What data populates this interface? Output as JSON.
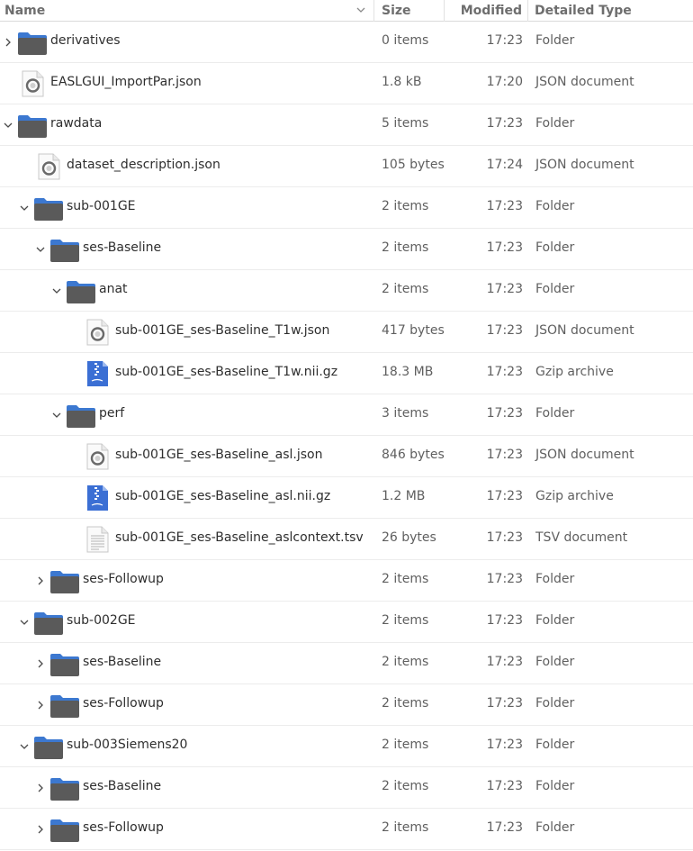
{
  "header": {
    "name": "Name",
    "size": "Size",
    "modified": "Modified",
    "type": "Detailed Type"
  },
  "rows": [
    {
      "depth": 0,
      "expander": "collapsed",
      "icon": "folder",
      "name": "derivatives",
      "size": "0 items",
      "modified": "17:23",
      "type": "Folder"
    },
    {
      "depth": 0,
      "expander": "none",
      "icon": "json",
      "name": "EASLGUI_ImportPar.json",
      "size": "1.8 kB",
      "modified": "17:20",
      "type": "JSON document"
    },
    {
      "depth": 0,
      "expander": "expanded",
      "icon": "folder",
      "name": "rawdata",
      "size": "5 items",
      "modified": "17:23",
      "type": "Folder"
    },
    {
      "depth": 1,
      "expander": "none",
      "icon": "json",
      "name": "dataset_description.json",
      "size": "105 bytes",
      "modified": "17:24",
      "type": "JSON document"
    },
    {
      "depth": 1,
      "expander": "expanded",
      "icon": "folder",
      "name": "sub-001GE",
      "size": "2 items",
      "modified": "17:23",
      "type": "Folder"
    },
    {
      "depth": 2,
      "expander": "expanded",
      "icon": "folder",
      "name": "ses-Baseline",
      "size": "2 items",
      "modified": "17:23",
      "type": "Folder"
    },
    {
      "depth": 3,
      "expander": "expanded",
      "icon": "folder",
      "name": "anat",
      "size": "2 items",
      "modified": "17:23",
      "type": "Folder"
    },
    {
      "depth": 4,
      "expander": "none",
      "icon": "json",
      "name": "sub-001GE_ses-Baseline_T1w.json",
      "size": "417 bytes",
      "modified": "17:23",
      "type": "JSON document"
    },
    {
      "depth": 4,
      "expander": "none",
      "icon": "gzip",
      "name": "sub-001GE_ses-Baseline_T1w.nii.gz",
      "size": "18.3 MB",
      "modified": "17:23",
      "type": "Gzip archive"
    },
    {
      "depth": 3,
      "expander": "expanded",
      "icon": "folder",
      "name": "perf",
      "size": "3 items",
      "modified": "17:23",
      "type": "Folder"
    },
    {
      "depth": 4,
      "expander": "none",
      "icon": "json",
      "name": "sub-001GE_ses-Baseline_asl.json",
      "size": "846 bytes",
      "modified": "17:23",
      "type": "JSON document"
    },
    {
      "depth": 4,
      "expander": "none",
      "icon": "gzip",
      "name": "sub-001GE_ses-Baseline_asl.nii.gz",
      "size": "1.2 MB",
      "modified": "17:23",
      "type": "Gzip archive"
    },
    {
      "depth": 4,
      "expander": "none",
      "icon": "text",
      "name": "sub-001GE_ses-Baseline_aslcontext.tsv",
      "size": "26 bytes",
      "modified": "17:23",
      "type": "TSV document"
    },
    {
      "depth": 2,
      "expander": "collapsed",
      "icon": "folder",
      "name": "ses-Followup",
      "size": "2 items",
      "modified": "17:23",
      "type": "Folder"
    },
    {
      "depth": 1,
      "expander": "expanded",
      "icon": "folder",
      "name": "sub-002GE",
      "size": "2 items",
      "modified": "17:23",
      "type": "Folder"
    },
    {
      "depth": 2,
      "expander": "collapsed",
      "icon": "folder",
      "name": "ses-Baseline",
      "size": "2 items",
      "modified": "17:23",
      "type": "Folder"
    },
    {
      "depth": 2,
      "expander": "collapsed",
      "icon": "folder",
      "name": "ses-Followup",
      "size": "2 items",
      "modified": "17:23",
      "type": "Folder"
    },
    {
      "depth": 1,
      "expander": "expanded",
      "icon": "folder",
      "name": "sub-003Siemens20",
      "size": "2 items",
      "modified": "17:23",
      "type": "Folder"
    },
    {
      "depth": 2,
      "expander": "collapsed",
      "icon": "folder",
      "name": "ses-Baseline",
      "size": "2 items",
      "modified": "17:23",
      "type": "Folder"
    },
    {
      "depth": 2,
      "expander": "collapsed",
      "icon": "folder",
      "name": "ses-Followup",
      "size": "2 items",
      "modified": "17:23",
      "type": "Folder"
    }
  ],
  "colors": {
    "folder_body": "#5a5a5a",
    "folder_tab": "#3c78d0",
    "gzip_icon": "#3b6fd4"
  }
}
